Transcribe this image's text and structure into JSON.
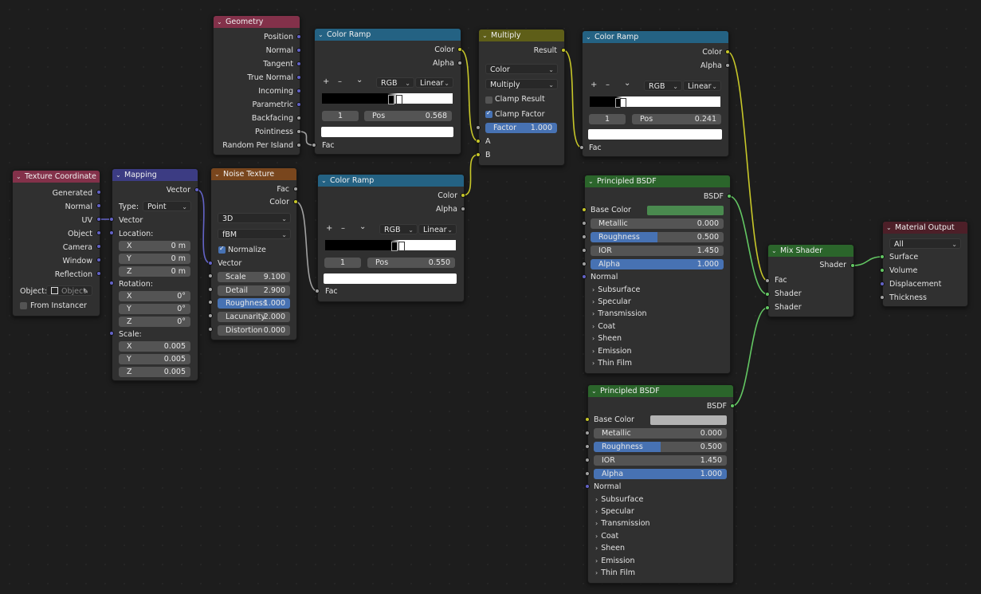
{
  "colors": {
    "canvas": "#1d1d1d",
    "node_body": "#303030",
    "header_input": "#83314a",
    "header_converter": "#3c3c83",
    "header_texture": "#79461d",
    "header_ramp": "#246283",
    "header_math": "#5e5e18",
    "header_shader": "#2b652b",
    "header_output": "#4d1f28",
    "socket_vector": "#6363c7",
    "socket_float": "#a1a1a1",
    "socket_color": "#c7c729",
    "socket_shader": "#63c763",
    "accent": "#4772b3"
  },
  "nodes": {
    "texture_coordinate": {
      "title": "Texture Coordinate",
      "outputs": [
        "Generated",
        "Normal",
        "UV",
        "Object",
        "Camera",
        "Window",
        "Reflection"
      ],
      "object_label": "Object:",
      "object_placeholder": "Object",
      "from_instancer": "From Instancer"
    },
    "mapping": {
      "title": "Mapping",
      "output": "Vector",
      "type_label": "Type:",
      "type_value": "Point",
      "vector_input": "Vector",
      "location_label": "Location:",
      "location": [
        {
          "axis": "X",
          "value": "0 m"
        },
        {
          "axis": "Y",
          "value": "0 m"
        },
        {
          "axis": "Z",
          "value": "0 m"
        }
      ],
      "rotation_label": "Rotation:",
      "rotation": [
        {
          "axis": "X",
          "value": "0°"
        },
        {
          "axis": "Y",
          "value": "0°"
        },
        {
          "axis": "Z",
          "value": "0°"
        }
      ],
      "scale_label": "Scale:",
      "scale": [
        {
          "axis": "X",
          "value": "0.005"
        },
        {
          "axis": "Y",
          "value": "0.005"
        },
        {
          "axis": "Z",
          "value": "0.005"
        }
      ]
    },
    "noise_texture": {
      "title": "Noise Texture",
      "outputs": [
        "Fac",
        "Color"
      ],
      "dimensions": "3D",
      "noise_type": "fBM",
      "normalize": "Normalize",
      "vector_input": "Vector",
      "params": [
        {
          "name": "Scale",
          "value": "9.100"
        },
        {
          "name": "Detail",
          "value": "2.900"
        },
        {
          "name": "Roughness",
          "value": "1.000"
        },
        {
          "name": "Lacunarity",
          "value": "2.000"
        },
        {
          "name": "Distortion",
          "value": "0.000"
        }
      ]
    },
    "geometry": {
      "title": "Geometry",
      "outputs": [
        "Position",
        "Normal",
        "Tangent",
        "True Normal",
        "Incoming",
        "Parametric",
        "Backfacing",
        "Pointiness",
        "Random Per Island"
      ]
    },
    "color_ramp_1": {
      "title": "Color Ramp",
      "outputs": [
        "Color",
        "Alpha"
      ],
      "mode": "RGB",
      "interpolation": "Linear",
      "index": "1",
      "pos_label": "Pos",
      "pos_value": "0.568",
      "input": "Fac"
    },
    "color_ramp_2": {
      "title": "Color Ramp",
      "outputs": [
        "Color",
        "Alpha"
      ],
      "mode": "RGB",
      "interpolation": "Linear",
      "index": "1",
      "pos_label": "Pos",
      "pos_value": "0.550",
      "input": "Fac"
    },
    "multiply": {
      "title": "Multiply",
      "output": "Result",
      "data_type": "Color",
      "blend_type": "Multiply",
      "clamp_result": "Clamp Result",
      "clamp_factor": "Clamp Factor",
      "factor_label": "Factor",
      "factor_value": "1.000",
      "inputs": [
        "A",
        "B"
      ]
    },
    "color_ramp_3": {
      "title": "Color Ramp",
      "outputs": [
        "Color",
        "Alpha"
      ],
      "mode": "RGB",
      "interpolation": "Linear",
      "index": "1",
      "pos_label": "Pos",
      "pos_value": "0.241",
      "input": "Fac"
    },
    "principled_1": {
      "title": "Principled BSDF",
      "output": "BSDF",
      "base_color_label": "Base Color",
      "base_color": "#4a8a4f",
      "params": [
        {
          "name": "Metallic",
          "value": "0.000"
        },
        {
          "name": "Roughness",
          "value": "0.500"
        },
        {
          "name": "IOR",
          "value": "1.450"
        },
        {
          "name": "Alpha",
          "value": "1.000"
        }
      ],
      "normal": "Normal",
      "panels": [
        "Subsurface",
        "Specular",
        "Transmission",
        "Coat",
        "Sheen",
        "Emission",
        "Thin Film"
      ]
    },
    "principled_2": {
      "title": "Principled BSDF",
      "output": "BSDF",
      "base_color_label": "Base Color",
      "base_color": "#b3b3b3",
      "params": [
        {
          "name": "Metallic",
          "value": "0.000"
        },
        {
          "name": "Roughness",
          "value": "0.500"
        },
        {
          "name": "IOR",
          "value": "1.450"
        },
        {
          "name": "Alpha",
          "value": "1.000"
        }
      ],
      "normal": "Normal",
      "panels": [
        "Subsurface",
        "Specular",
        "Transmission",
        "Coat",
        "Sheen",
        "Emission",
        "Thin Film"
      ]
    },
    "mix_shader": {
      "title": "Mix Shader",
      "output": "Shader",
      "inputs": [
        "Fac",
        "Shader",
        "Shader"
      ]
    },
    "material_output": {
      "title": "Material Output",
      "target": "All",
      "inputs": [
        "Surface",
        "Volume",
        "Displacement",
        "Thickness"
      ]
    }
  }
}
